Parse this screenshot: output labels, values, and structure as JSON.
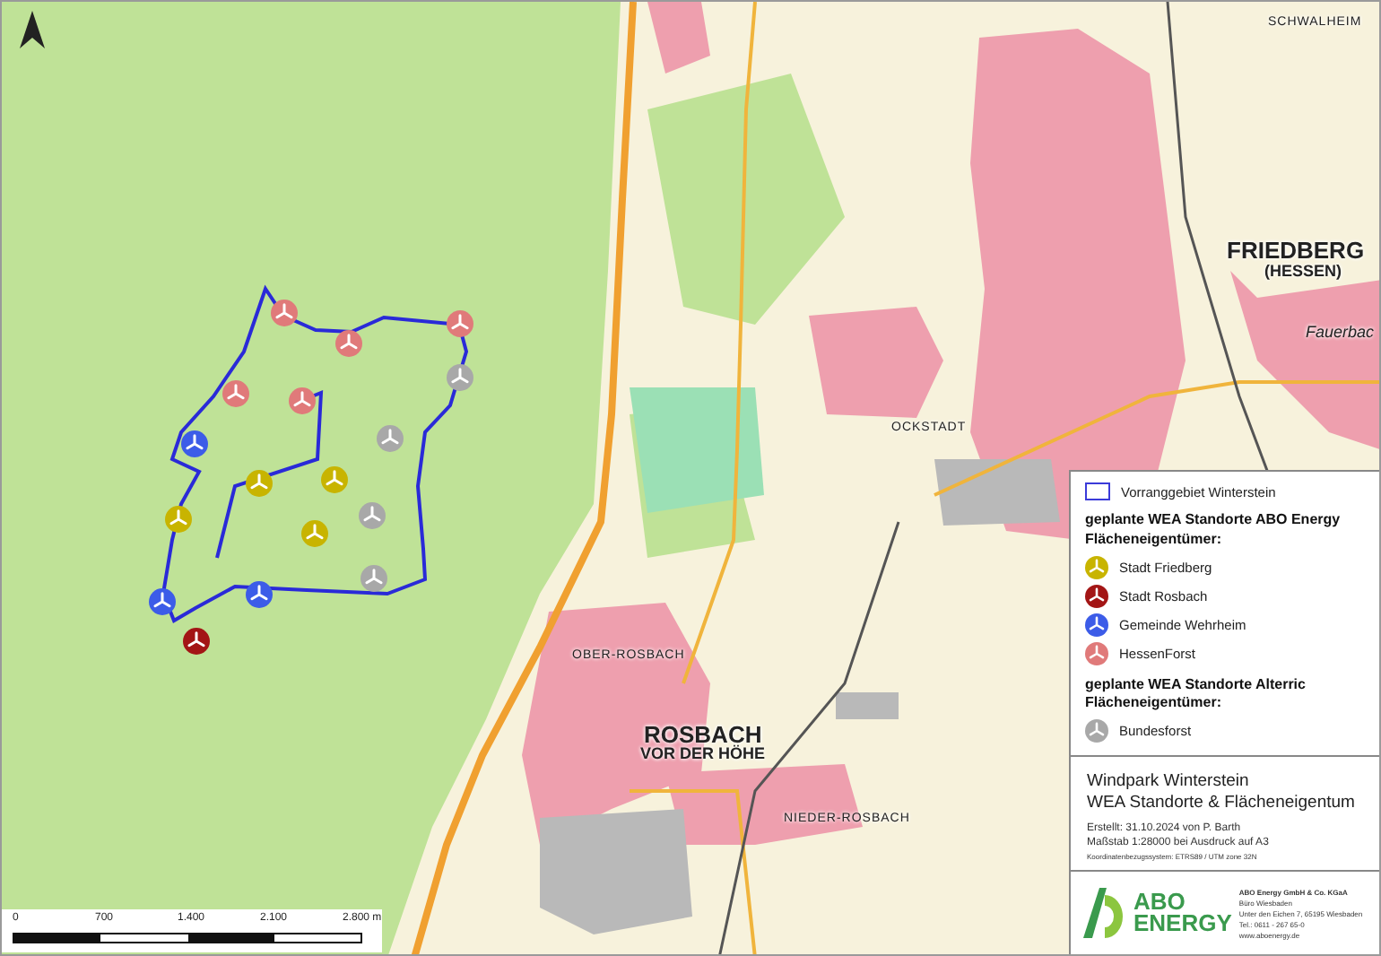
{
  "map": {
    "places": [
      {
        "text": "SCHWALHEIM",
        "kind": "town"
      },
      {
        "text": "FRIEDBERG",
        "kind": "city"
      },
      {
        "text": "(HESSEN)",
        "kind": "city-sub"
      },
      {
        "text": "Fauerbac",
        "kind": "district"
      },
      {
        "text": "OCKSTADT",
        "kind": "town"
      },
      {
        "text": "OBER-ROSBACH",
        "kind": "town"
      },
      {
        "text": "ROSBACH",
        "kind": "city"
      },
      {
        "text": "VOR DER HÖHE",
        "kind": "city-sub"
      },
      {
        "text": "NIEDER-ROSBACH",
        "kind": "town"
      }
    ],
    "turbines": [
      {
        "color": "#e07a7a"
      },
      {
        "color": "#e07a7a"
      },
      {
        "color": "#e07a7a"
      },
      {
        "color": "#e07a7a"
      },
      {
        "color": "#e07a7a"
      },
      {
        "color": "#a8a8a8"
      },
      {
        "color": "#a8a8a8"
      },
      {
        "color": "#a8a8a8"
      },
      {
        "color": "#a8a8a8"
      },
      {
        "color": "#3c5ce8"
      },
      {
        "color": "#3c5ce8"
      },
      {
        "color": "#3c5ce8"
      },
      {
        "color": "#c8b400"
      },
      {
        "color": "#c8b400"
      },
      {
        "color": "#c8b400"
      },
      {
        "color": "#c8b400"
      },
      {
        "color": "#a31515"
      }
    ]
  },
  "scale_bar": {
    "labels": [
      "0",
      "700",
      "1.400",
      "2.100",
      "2.800 m"
    ]
  },
  "legend": {
    "items": [
      {
        "kind": "area",
        "label": "Vorranggebiet Winterstein"
      },
      {
        "kind": "heading",
        "lines": [
          "geplante WEA Standorte ABO Energy",
          "Flächeneigentümer:"
        ]
      },
      {
        "kind": "turbine",
        "label": "Stadt Friedberg",
        "color": "#c8b400"
      },
      {
        "kind": "turbine",
        "label": "Stadt Rosbach",
        "color": "#a31515"
      },
      {
        "kind": "turbine",
        "label": "Gemeinde Wehrheim",
        "color": "#3c5ce8"
      },
      {
        "kind": "turbine",
        "label": "HessenForst",
        "color": "#e07a7a"
      },
      {
        "kind": "heading",
        "lines": [
          "geplante WEA Standorte Alterric",
          "Flächeneigentümer:"
        ]
      },
      {
        "kind": "turbine",
        "label": "Bundesforst",
        "color": "#a8a8a8"
      }
    ]
  },
  "title_block": {
    "title": [
      "Windpark Winterstein",
      "WEA Standorte & Flächeneigentum"
    ],
    "created": "Erstellt: 31.10.2024 von P. Barth",
    "scale": "Maßstab 1:28000  bei Ausdruck auf A3",
    "crs": "Koordinatenbezugssystem: ETRS89 / UTM zone 32N"
  },
  "company": {
    "logo": [
      "ABO",
      "ENERGY"
    ],
    "name": "ABO Energy GmbH & Co. KGaA",
    "address": [
      "Büro Wiesbaden",
      "Unter den Eichen 7, 65195 Wiesbaden",
      "Tel.: 0611 - 267 65-0",
      "www.aboenergy.de"
    ]
  }
}
